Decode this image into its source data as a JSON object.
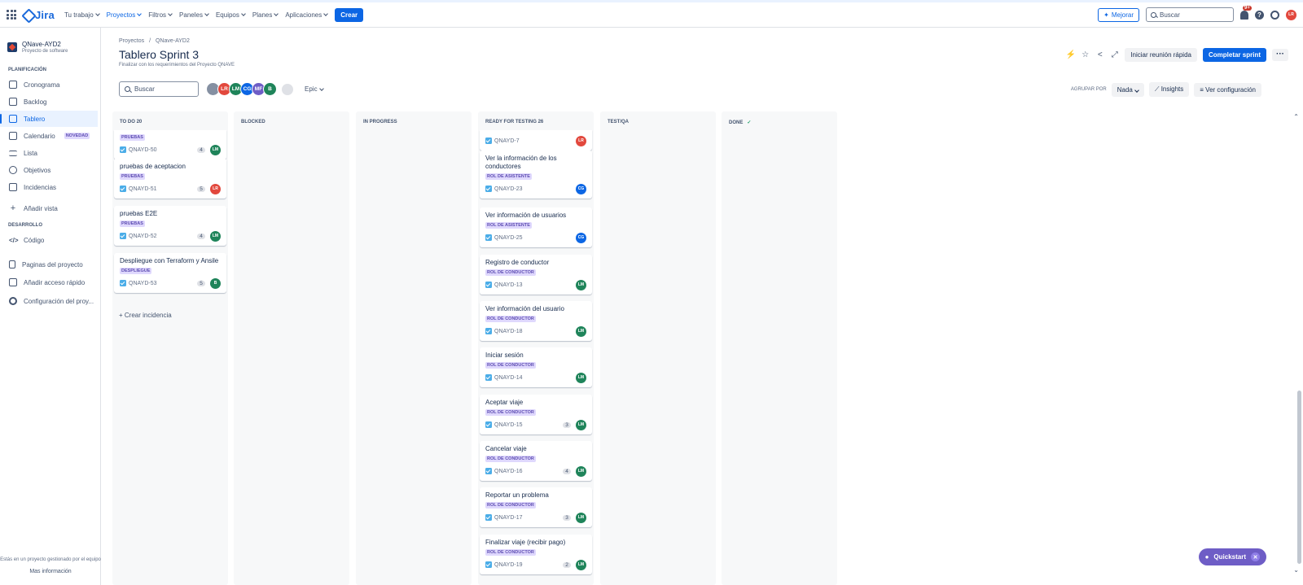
{
  "topnav": {
    "logo": "Jira",
    "items": [
      "Tu trabajo",
      "Proyectos",
      "Filtros",
      "Paneles",
      "Equipos",
      "Planes",
      "Aplicaciones"
    ],
    "create": "Crear",
    "upgrade": "Mejorar",
    "search_placeholder": "Buscar",
    "notifications_badge": "9+",
    "user_initials": "LR"
  },
  "sidebar": {
    "project_name": "QNave-AYD2",
    "project_type": "Proyecto de software",
    "planning_label": "PLANIFICACIÓN",
    "planning_items": [
      "Cronograma",
      "Backlog",
      "Tablero",
      "Calendario",
      "Lista",
      "Objetivos",
      "Incidencias"
    ],
    "calendar_badge": "NOVEDAD",
    "add_view": "Añadir vista",
    "dev_label": "DESARROLLO",
    "dev_items": [
      "Código"
    ],
    "bottom_items": [
      "Paginas del proyecto",
      "Añadir acceso rápido",
      "Configuración del proy..."
    ],
    "footer_note": "Estás en un proyecto gestionado por el equipo",
    "footer_link": "Mas información"
  },
  "header": {
    "breadcrumb_1": "Proyectos",
    "breadcrumb_sep": "/",
    "breadcrumb_2": "QNave-AYD2",
    "title": "Tablero Sprint 3",
    "subtitle": "Finalizar con los requerimientos del Proyecto QNAVE",
    "quick_meeting": "Iniciar reunión rápida",
    "complete_sprint": "Completar sprint",
    "more": "···"
  },
  "filters": {
    "search_placeholder": "Buscar",
    "avatars": [
      "LR",
      "LM",
      "CG",
      "MF",
      "B"
    ],
    "epic": "Epic",
    "group_by_label": "AGRUPAR POR",
    "group_by_value": "Nada",
    "insights": "Insights",
    "view_settings": "Ver configuración"
  },
  "columns": [
    {
      "name": "TO DO",
      "count": "20"
    },
    {
      "name": "BLOCKED",
      "count": ""
    },
    {
      "name": "IN PROGRESS",
      "count": ""
    },
    {
      "name": "READY FOR TESTING",
      "count": "26"
    },
    {
      "name": "TEST/QA",
      "count": ""
    },
    {
      "name": "DONE",
      "count": "✓"
    }
  ],
  "todo_cards": [
    {
      "title": "",
      "label": "PRUEBAS",
      "key": "QNAYD-50",
      "points": "4",
      "assignee": "LM"
    },
    {
      "title": "pruebas de aceptacion",
      "label": "PRUEBAS",
      "key": "QNAYD-51",
      "points": "5",
      "assignee": "LR"
    },
    {
      "title": "pruebas E2E",
      "label": "PRUEBAS",
      "key": "QNAYD-52",
      "points": "4",
      "assignee": "LM"
    },
    {
      "title": "Despliegue con Terraform y Ansile",
      "label": "DESPLIEGUE",
      "key": "QNAYD-53",
      "points": "5",
      "assignee": "B"
    }
  ],
  "create_issue": "+ Crear incidencia",
  "rft_cards": [
    {
      "title": "",
      "label": "",
      "key": "QNAYD-7",
      "points": "",
      "assignee": "LR"
    },
    {
      "title": "Ver la información de los conductores",
      "label": "ROL DE ASISTENTE",
      "key": "QNAYD-23",
      "points": "",
      "assignee": "CG"
    },
    {
      "title": "Ver información de usuarios",
      "label": "ROL DE ASISTENTE",
      "key": "QNAYD-25",
      "points": "",
      "assignee": "CG"
    },
    {
      "title": "Registro de conductor",
      "label": "ROL DE CONDUCTOR",
      "key": "QNAYD-13",
      "points": "",
      "assignee": "LM"
    },
    {
      "title": "Ver información del usuario",
      "label": "ROL DE CONDUCTOR",
      "key": "QNAYD-18",
      "points": "",
      "assignee": "LM"
    },
    {
      "title": "Iniciar sesión",
      "label": "ROL DE CONDUCTOR",
      "key": "QNAYD-14",
      "points": "",
      "assignee": "LM"
    },
    {
      "title": "Aceptar viaje",
      "label": "ROL DE CONDUCTOR",
      "key": "QNAYD-15",
      "points": "3",
      "assignee": "LM"
    },
    {
      "title": "Cancelar viaje",
      "label": "ROL DE CONDUCTOR",
      "key": "QNAYD-16",
      "points": "4",
      "assignee": "LM"
    },
    {
      "title": "Reportar un problema",
      "label": "ROL DE CONDUCTOR",
      "key": "QNAYD-17",
      "points": "3",
      "assignee": "LM"
    },
    {
      "title": "Finalizar viaje (recibir pago)",
      "label": "ROL DE CONDUCTOR",
      "key": "QNAYD-19",
      "points": "2",
      "assignee": "LM"
    }
  ],
  "quickstart": "Quickstart",
  "colors": {
    "accent": "#0c66e4",
    "LR": "#e2483d",
    "LM": "#1f845a",
    "CG": "#0c66e4",
    "MF": "#6e5dc6",
    "B": "#1f845a"
  }
}
